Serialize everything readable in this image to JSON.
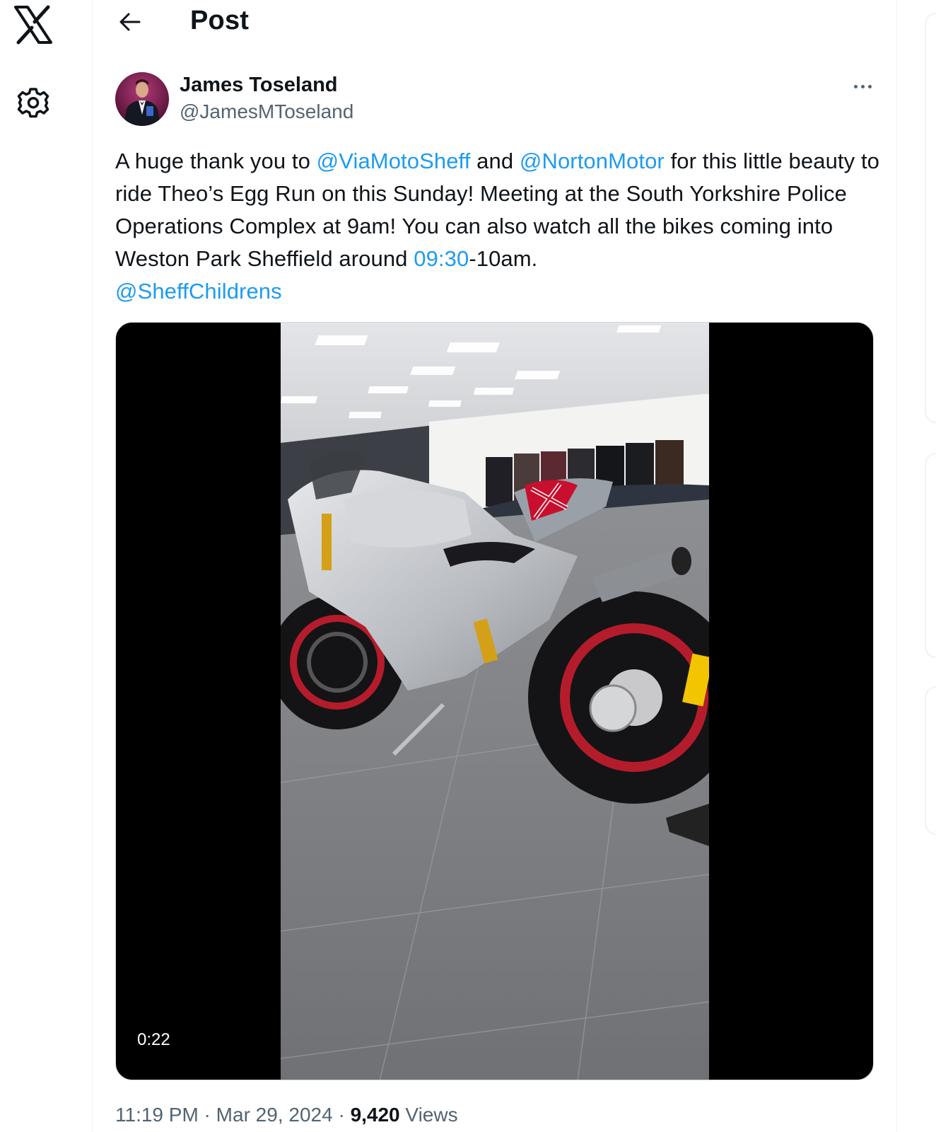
{
  "header": {
    "title": "Post"
  },
  "post": {
    "author_name": "James Toseland",
    "author_handle": "@JamesMToseland",
    "text_segments": {
      "s1": "A huge thank you to ",
      "m1": "@ViaMotoSheff",
      "s2": " and ",
      "m2": "@NortonMotor",
      "s3": " for this little beauty to ride Theo’s Egg Run on this Sunday! Meeting at the South Yorkshire Police Operations Complex at 9am! You can also watch all the bikes coming into Weston Park Sheffield around ",
      "t1": "09:30",
      "s4": "-10am. ",
      "m3": "@SheffChildrens"
    },
    "video": {
      "duration": "0:22"
    },
    "meta": {
      "time": "11:19 PM",
      "sep1": " · ",
      "date": "Mar 29, 2024",
      "sep2": " · ",
      "views_count": "9,420",
      "views_label": " Views"
    }
  },
  "colors": {
    "link": "#1d9bf0",
    "text": "#0f1419",
    "muted": "#536471",
    "divider": "#eff3f4"
  },
  "icons": {
    "logo": "x-logo-icon",
    "settings": "gear-icon",
    "back": "arrow-left-icon",
    "more": "more-horizontal-icon"
  }
}
